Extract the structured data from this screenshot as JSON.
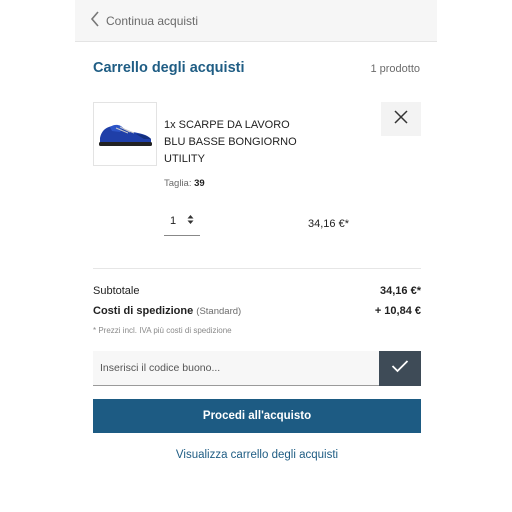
{
  "header": {
    "back_label": "Continua acquisti"
  },
  "cart": {
    "title": "Carrello degli acquisti",
    "count": "1 prodotto"
  },
  "item": {
    "name": "1x SCARPE DA LAVORO BLU BASSE BONGIORNO UTILITY",
    "size_label": "Taglia:",
    "size_value": "39",
    "quantity": "1",
    "price": "34,16 €*"
  },
  "summary": {
    "subtotal_label": "Subtotale",
    "subtotal_value": "34,16 €*",
    "shipping_label": "Costi di spedizione",
    "shipping_method": "(Standard)",
    "shipping_value": "+ 10,84 €",
    "tax_note": "* Prezzi incl. IVA più costi di spedizione"
  },
  "voucher": {
    "placeholder": "Inserisci il codice buono..."
  },
  "actions": {
    "checkout_label": "Procedi all'acquisto",
    "view_cart_label": "Visualizza carrello degli acquisti"
  },
  "colors": {
    "accent": "#1d5b83",
    "voucher_button": "#3e4b57"
  },
  "icons": {
    "back": "chevron-left-icon",
    "remove": "close-icon",
    "quantity": "sort-arrows-icon",
    "voucher_submit": "checkmark-icon",
    "product": "work-shoe-image"
  }
}
